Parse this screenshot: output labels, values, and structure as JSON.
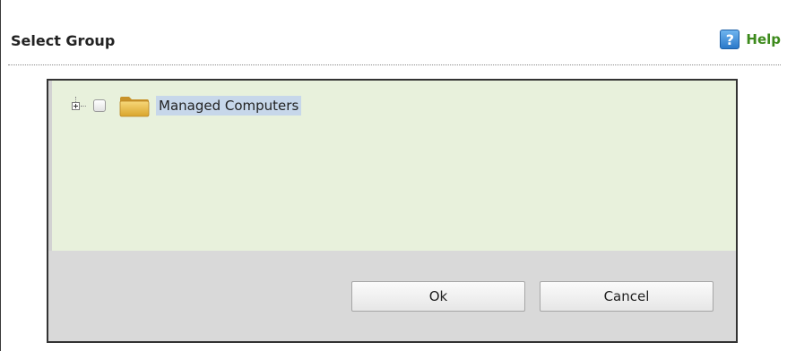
{
  "dialog": {
    "title": "Select Group",
    "help": {
      "label": "Help",
      "icon": "help-question-icon",
      "icon_glyph": "?"
    }
  },
  "tree": {
    "nodes": [
      {
        "label": "Managed Computers",
        "expanded": false,
        "checked": false,
        "selected": true,
        "icon": "folder-icon"
      }
    ]
  },
  "buttons": {
    "ok": "Ok",
    "cancel": "Cancel"
  },
  "colors": {
    "tree_background": "#e8f1dc",
    "button_bar": "#d9d9d9",
    "help_text": "#3d8a1c",
    "selection": "#c7d7ea"
  }
}
